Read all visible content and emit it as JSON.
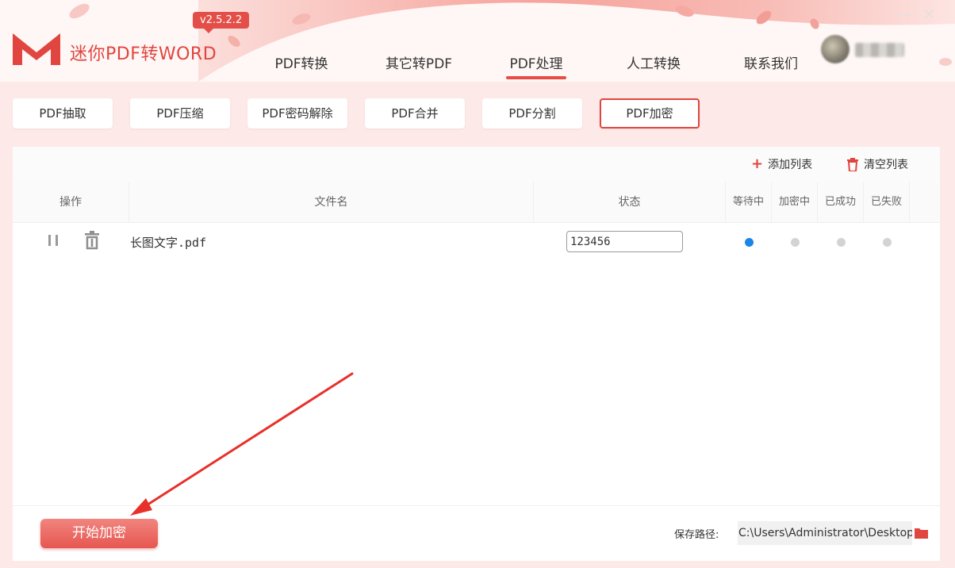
{
  "app": {
    "title": "迷你PDF转WORD",
    "version": "v2.5.2.2",
    "brand_color": "#e0463f"
  },
  "window": {
    "minimize": "—",
    "close": "✕"
  },
  "nav": {
    "items": [
      {
        "label": "PDF转换"
      },
      {
        "label": "其它转PDF"
      },
      {
        "label": "PDF处理",
        "active": true
      },
      {
        "label": "人工转换"
      },
      {
        "label": "联系我们"
      }
    ]
  },
  "subtabs": [
    {
      "label": "PDF抽取"
    },
    {
      "label": "PDF压缩"
    },
    {
      "label": "PDF密码解除"
    },
    {
      "label": "PDF合并"
    },
    {
      "label": "PDF分割"
    },
    {
      "label": "PDF加密",
      "active": true
    }
  ],
  "toolbar": {
    "add_label": "添加列表",
    "clear_label": "清空列表",
    "add_icon": "plus-icon",
    "clear_icon": "trash-icon"
  },
  "table": {
    "headers": {
      "operation": "操作",
      "filename": "文件名",
      "status": "状态",
      "waiting": "等待中",
      "encrypting": "加密中",
      "success": "已成功",
      "failed": "已失败"
    },
    "rows": [
      {
        "filename": "长图文字.pdf",
        "password": "123456",
        "state": "waiting"
      }
    ]
  },
  "colors": {
    "active_dot": "#1a86e6",
    "inactive_dot": "#d3d3d3"
  },
  "footer": {
    "start_label": "开始加密",
    "save_label": "保存路径:",
    "save_path": "C:\\Users\\Administrator\\Desktop\\"
  }
}
